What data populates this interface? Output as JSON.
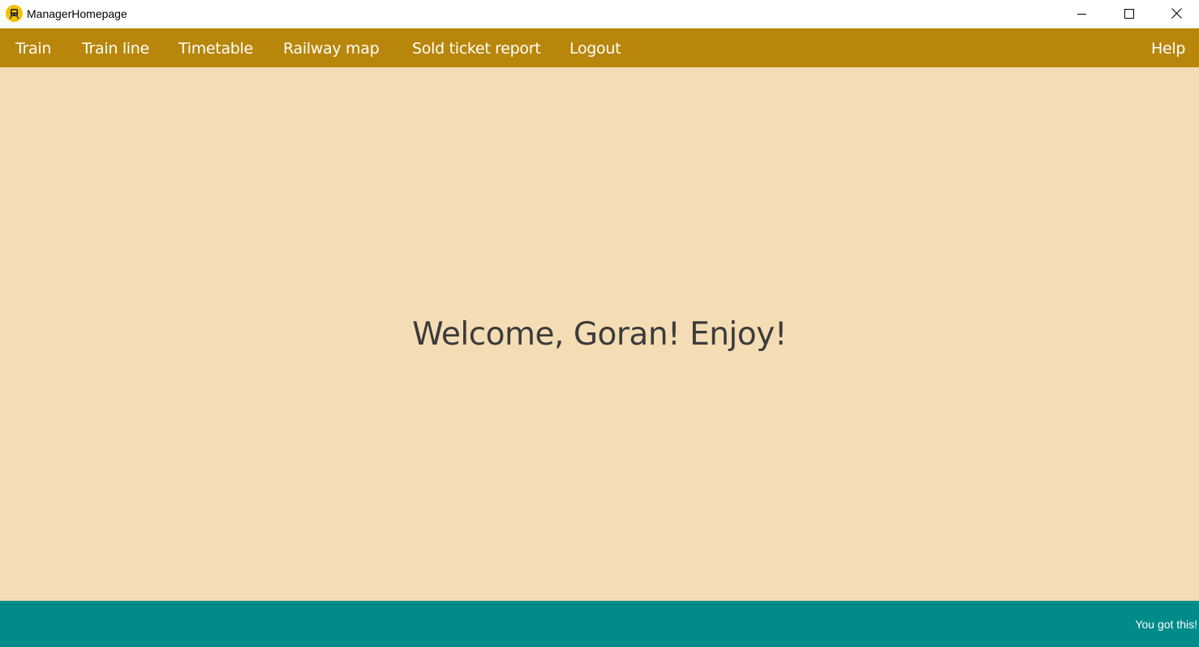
{
  "window": {
    "title": "ManagerHomepage",
    "icon": "train-icon",
    "controls": [
      "minimize-icon",
      "maximize-icon",
      "close-icon"
    ]
  },
  "menu": {
    "items": [
      {
        "label": "Train"
      },
      {
        "label": "Train line"
      },
      {
        "label": "Timetable"
      },
      {
        "label": "Railway map"
      },
      {
        "label": "Sold ticket report"
      },
      {
        "label": "Logout"
      }
    ],
    "help_label": "Help"
  },
  "main": {
    "welcome_text": "Welcome, Goran! Enjoy!"
  },
  "status": {
    "text": "You got this!"
  },
  "colors": {
    "menubar": "#b8860b",
    "background": "#f4ddb4",
    "statusbar": "#008b8b",
    "app_icon": "#f2c200"
  }
}
